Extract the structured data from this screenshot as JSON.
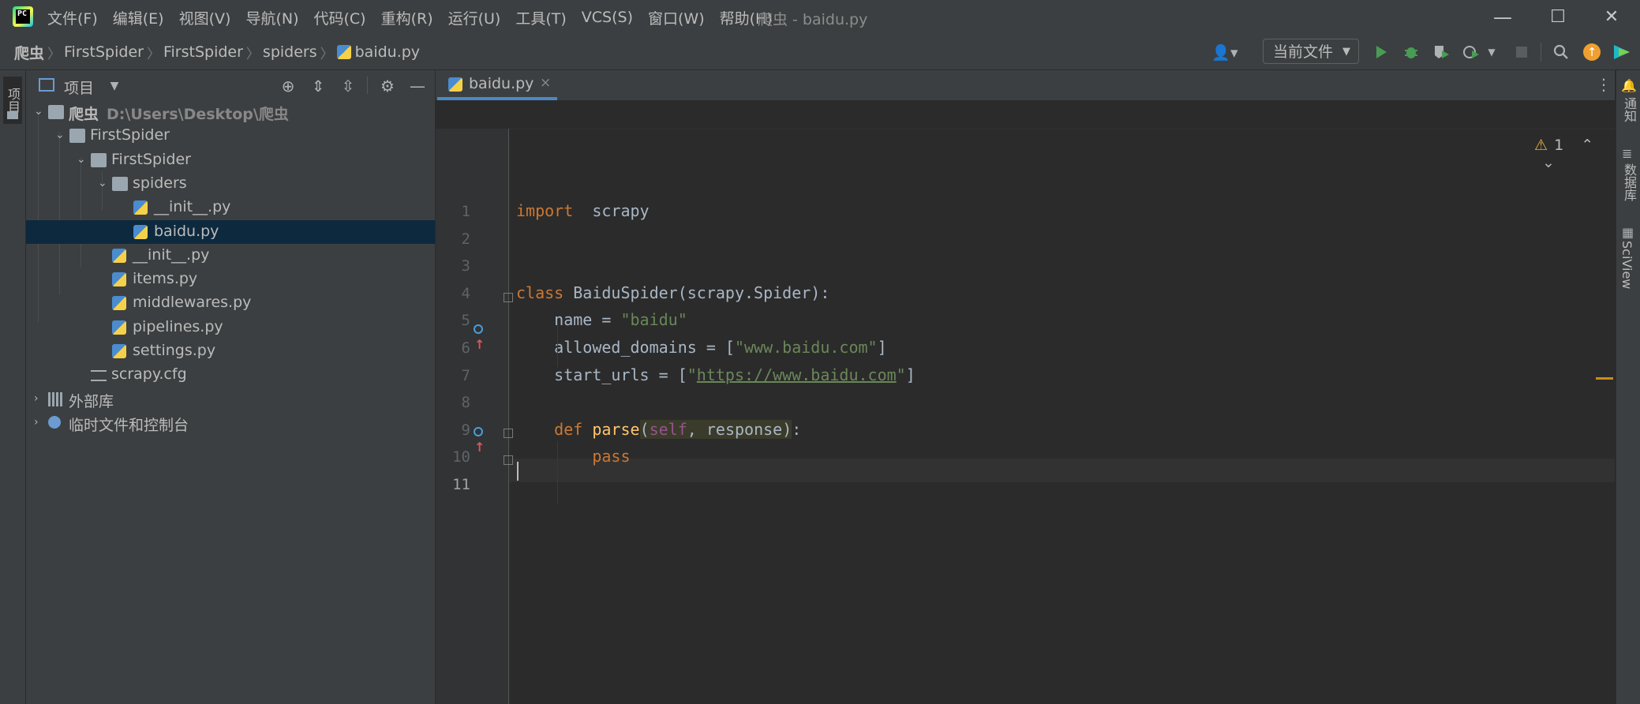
{
  "window": {
    "title": "爬虫 - baidu.py",
    "menu": [
      "文件(F)",
      "编辑(E)",
      "视图(V)",
      "导航(N)",
      "代码(C)",
      "重构(R)",
      "运行(U)",
      "工具(T)",
      "VCS(S)",
      "窗口(W)",
      "帮助(H)"
    ],
    "minimize": "—",
    "maximize": "☐",
    "close": "✕"
  },
  "breadcrumb": [
    "爬虫",
    "FirstSpider",
    "FirstSpider",
    "spiders",
    "baidu.py"
  ],
  "toolbar": {
    "run_config": "当前文件",
    "icons": [
      "user-icon",
      "run-icon",
      "debug-icon",
      "coverage-icon",
      "profile-icon",
      "stop-icon",
      "search-icon",
      "update-icon",
      "jetbrains-ai-icon"
    ]
  },
  "left_strip": {
    "project_label": "项目"
  },
  "project_panel": {
    "title": "项目",
    "tree": [
      {
        "label": "爬虫",
        "hint": "D:\\Users\\Desktop\\爬虫",
        "type": "folder",
        "depth": 0,
        "expanded": true,
        "bold": true
      },
      {
        "label": "FirstSpider",
        "type": "folder",
        "depth": 1,
        "expanded": true
      },
      {
        "label": "FirstSpider",
        "type": "package",
        "depth": 2,
        "expanded": true
      },
      {
        "label": "spiders",
        "type": "package",
        "depth": 3,
        "expanded": true
      },
      {
        "label": "__init__.py",
        "type": "py",
        "depth": 4
      },
      {
        "label": "baidu.py",
        "type": "py",
        "depth": 4,
        "selected": true
      },
      {
        "label": "__init__.py",
        "type": "py",
        "depth": 3
      },
      {
        "label": "items.py",
        "type": "py",
        "depth": 3
      },
      {
        "label": "middlewares.py",
        "type": "py",
        "depth": 3
      },
      {
        "label": "pipelines.py",
        "type": "py",
        "depth": 3
      },
      {
        "label": "settings.py",
        "type": "py",
        "depth": 3
      },
      {
        "label": "scrapy.cfg",
        "type": "cfg",
        "depth": 2
      },
      {
        "label": "外部库",
        "type": "lib",
        "depth": 0,
        "expanded": false
      },
      {
        "label": "临时文件和控制台",
        "type": "scratch",
        "depth": 0,
        "expanded": false
      }
    ]
  },
  "editor": {
    "tab": {
      "label": "baidu.py",
      "close": "×"
    },
    "warnings": {
      "count": "1",
      "icon": "warning-icon"
    },
    "line_numbers": [
      "1",
      "2",
      "3",
      "4",
      "5",
      "6",
      "7",
      "8",
      "9",
      "10",
      "11"
    ],
    "lines": [
      {
        "parts": [
          [
            "kw",
            "import"
          ],
          [
            "",
            "  scrapy"
          ]
        ]
      },
      {
        "parts": []
      },
      {
        "parts": []
      },
      {
        "parts": [
          [
            "kw",
            "class"
          ],
          [
            "",
            " BaiduSpider(scrapy.Spider):"
          ]
        ]
      },
      {
        "parts": [
          [
            "",
            "    name = "
          ],
          [
            "str",
            "\"baidu\""
          ]
        ]
      },
      {
        "parts": [
          [
            "",
            "    allowed_domains = ["
          ],
          [
            "str",
            "\"www.baidu.com\""
          ],
          [
            "",
            "]"
          ]
        ]
      },
      {
        "parts": [
          [
            "",
            "    start_urls = ["
          ],
          [
            "str",
            "\""
          ],
          [
            "url",
            "https://www.baidu.com"
          ],
          [
            "str",
            "\""
          ],
          [
            "",
            "]"
          ]
        ]
      },
      {
        "parts": []
      },
      {
        "parts": [
          [
            "",
            "    "
          ],
          [
            "kw",
            "def"
          ],
          [
            "",
            " "
          ],
          [
            "fn",
            "parse"
          ],
          [
            "hl",
            "("
          ],
          [
            "hlself",
            "self"
          ],
          [
            "hl",
            ", response)"
          ],
          [
            "",
            ":"
          ]
        ]
      },
      {
        "parts": [
          [
            "",
            "        "
          ],
          [
            "kw",
            "pass"
          ]
        ]
      },
      {
        "parts": []
      }
    ]
  },
  "right_strip": [
    "通知",
    "数据库",
    "SciView"
  ],
  "colors": {
    "accent": "#4a88c7",
    "keyword": "#cc7832",
    "string": "#6a8759",
    "function": "#ffc66d",
    "self": "#94558d"
  }
}
